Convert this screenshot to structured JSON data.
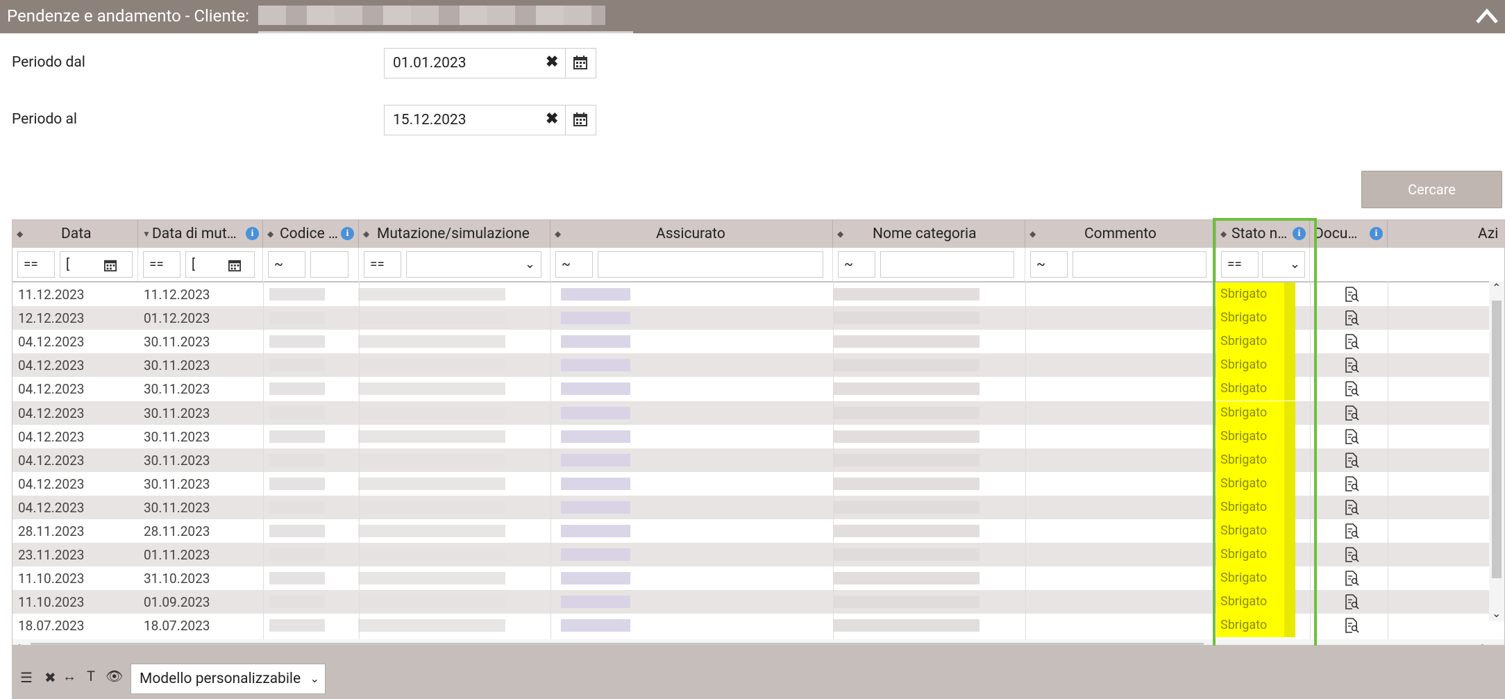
{
  "window": {
    "title": "Pendenze e andamento - Cliente:"
  },
  "filters": {
    "from_label": "Periodo dal",
    "from_value": "01.01.2023",
    "to_label": "Periodo al",
    "to_value": "15.12.2023",
    "search_label": "Cercare"
  },
  "grid": {
    "columns": [
      "Data",
      "Data di mut…",
      "Codice …",
      "Mutazione/simulazione",
      "Assicurato",
      "Nome categoria",
      "Commento",
      "Stato n…",
      "Docu…",
      "Azi"
    ],
    "filter_ops": {
      "eq": "==",
      "like": "~"
    },
    "rows": [
      {
        "data": "11.12.2023",
        "data_mut": "11.12.2023",
        "stato": "Sbrigato"
      },
      {
        "data": "12.12.2023",
        "data_mut": "01.12.2023",
        "stato": "Sbrigato"
      },
      {
        "data": "04.12.2023",
        "data_mut": "30.11.2023",
        "stato": "Sbrigato"
      },
      {
        "data": "04.12.2023",
        "data_mut": "30.11.2023",
        "stato": "Sbrigato"
      },
      {
        "data": "04.12.2023",
        "data_mut": "30.11.2023",
        "stato": "Sbrigato"
      },
      {
        "data": "04.12.2023",
        "data_mut": "30.11.2023",
        "stato": "Sbrigato"
      },
      {
        "data": "04.12.2023",
        "data_mut": "30.11.2023",
        "stato": "Sbrigato"
      },
      {
        "data": "04.12.2023",
        "data_mut": "30.11.2023",
        "stato": "Sbrigato"
      },
      {
        "data": "04.12.2023",
        "data_mut": "30.11.2023",
        "stato": "Sbrigato"
      },
      {
        "data": "04.12.2023",
        "data_mut": "30.11.2023",
        "stato": "Sbrigato"
      },
      {
        "data": "28.11.2023",
        "data_mut": "28.11.2023",
        "stato": "Sbrigato"
      },
      {
        "data": "23.11.2023",
        "data_mut": "01.11.2023",
        "stato": "Sbrigato"
      },
      {
        "data": "11.10.2023",
        "data_mut": "31.10.2023",
        "stato": "Sbrigato"
      },
      {
        "data": "11.10.2023",
        "data_mut": "01.09.2023",
        "stato": "Sbrigato"
      },
      {
        "data": "18.07.2023",
        "data_mut": "18.07.2023",
        "stato": "Sbrigato"
      }
    ]
  },
  "footer": {
    "template_label": "Modello personalizzabile"
  },
  "colors": {
    "titlebar": "#8d817c",
    "header": "#d2c9c6",
    "highlight": "#6cc13a",
    "status_bg": "#ffff00"
  }
}
